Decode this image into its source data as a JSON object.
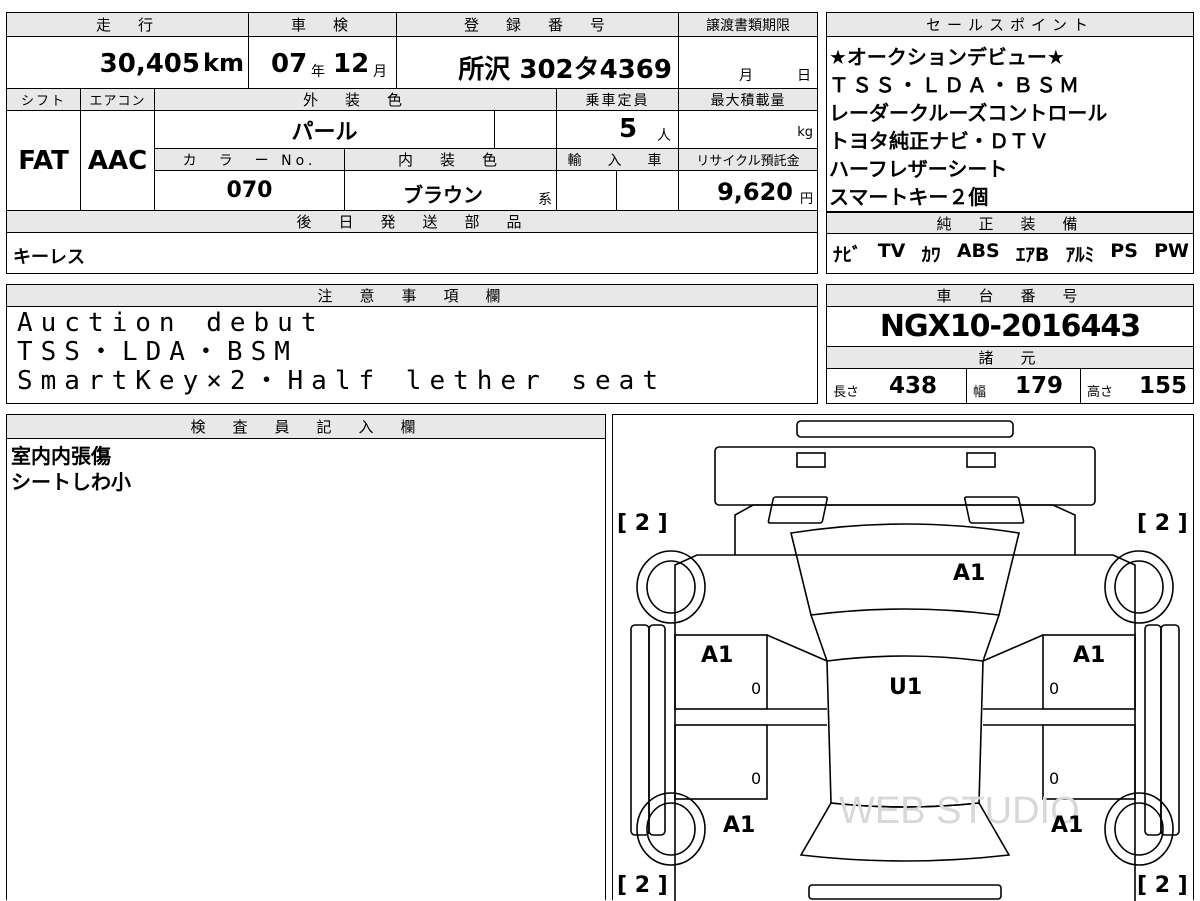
{
  "top_main": {
    "headers": {
      "mileage": "走　行",
      "inspection": "車　検",
      "registration": "登　録　番　号",
      "transfer_deadline": "譲渡書類期限"
    },
    "mileage_value": "30,405",
    "mileage_unit": "km",
    "inspection_year": "07",
    "inspection_year_unit": "年",
    "inspection_month": "12",
    "inspection_month_unit": "月",
    "registration_value": "所沢 302タ4369",
    "deadline_month_unit": "月",
    "deadline_day_unit": "日",
    "row2_headers": {
      "shift": "シフト",
      "aircon": "エアコン",
      "exterior_color": "外　装　色",
      "capacity": "乗車定員",
      "max_load": "最大積載量"
    },
    "shift_value": "FAT",
    "aircon_value": "AAC",
    "exterior_color_value": "パール",
    "capacity_value": "5",
    "capacity_unit": "人",
    "max_load_unit": "kg",
    "row3_headers": {
      "color_no": "カ　ラ　ー No.",
      "interior_color": "内　装　色",
      "import": "輸　入　車",
      "recycle": "リサイクル預託金"
    },
    "color_no_value": "070",
    "interior_color_value": "ブラウン",
    "interior_color_suffix": "系",
    "recycle_value": "9,620",
    "recycle_unit": "円",
    "later_parts_header": "後　日　発　送　部　品",
    "later_parts_value": "キーレス"
  },
  "sales_points": {
    "header": "セールスポイント",
    "lines": [
      "★オークションデビュー★",
      "ＴＳＳ・ＬＤＡ・ＢＳＭ",
      "レーダークルーズコントロール",
      "トヨタ純正ナビ・ＤＴＶ",
      "ハーフレザーシート",
      "スマートキー２個"
    ]
  },
  "factory_equipment": {
    "header": "純　正　装　備",
    "items": [
      "ﾅﾋﾞ",
      "TV",
      "ｶﾜ",
      "ABS",
      "ｴｱB",
      "ｱﾙﾐ",
      "PS",
      "PW"
    ]
  },
  "notes": {
    "header": "注　意　事　項　欄",
    "lines": [
      "Auction debut",
      "TSS・LDA・BSM",
      "SmartKey×2・Half lether seat"
    ]
  },
  "chassis": {
    "header": "車　台　番　号",
    "value": "NGX10-2016443",
    "spec_header": "諸　元",
    "length_label": "長さ",
    "length_value": "438",
    "width_label": "幅",
    "width_value": "179",
    "height_label": "高さ",
    "height_value": "155"
  },
  "inspector": {
    "header": "検　査　員　記　入　欄",
    "lines": [
      "室内内張傷",
      "シートしわ小"
    ]
  },
  "diagram": {
    "labels": {
      "bracket_tl": "[ 2 ]",
      "bracket_tr": "[ 2 ]",
      "bracket_bl": "[ 2 ]",
      "bracket_br": "[ 2 ]",
      "hood": "A1",
      "front_left_door": "A1",
      "front_right_door": "A1",
      "roof": "U1",
      "rear_left": "A1",
      "rear_right": "A1",
      "zero_1": "0",
      "zero_2": "0",
      "zero_3": "0",
      "zero_4": "0"
    },
    "watermark": "WEB STUDIO"
  }
}
